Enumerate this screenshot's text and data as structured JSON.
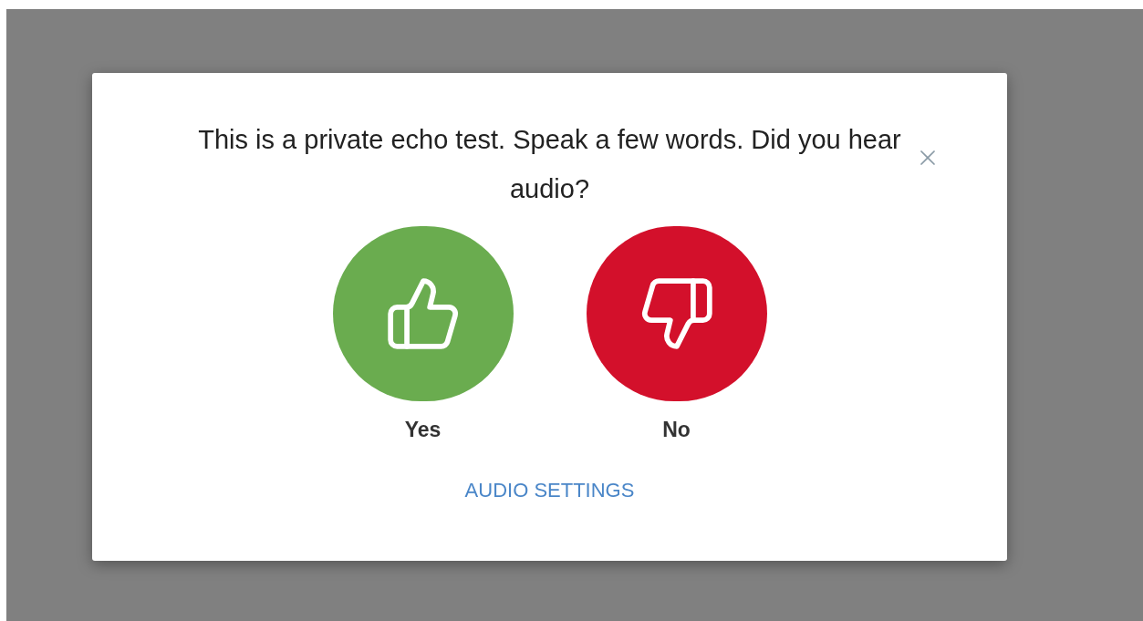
{
  "dialog": {
    "title": "This is a private echo test. Speak a few words. Did you hear audio?",
    "answers": [
      {
        "kind": "yes",
        "label": "Yes"
      },
      {
        "kind": "no",
        "label": "No"
      }
    ],
    "settings_link": "AUDIO SETTINGS"
  }
}
